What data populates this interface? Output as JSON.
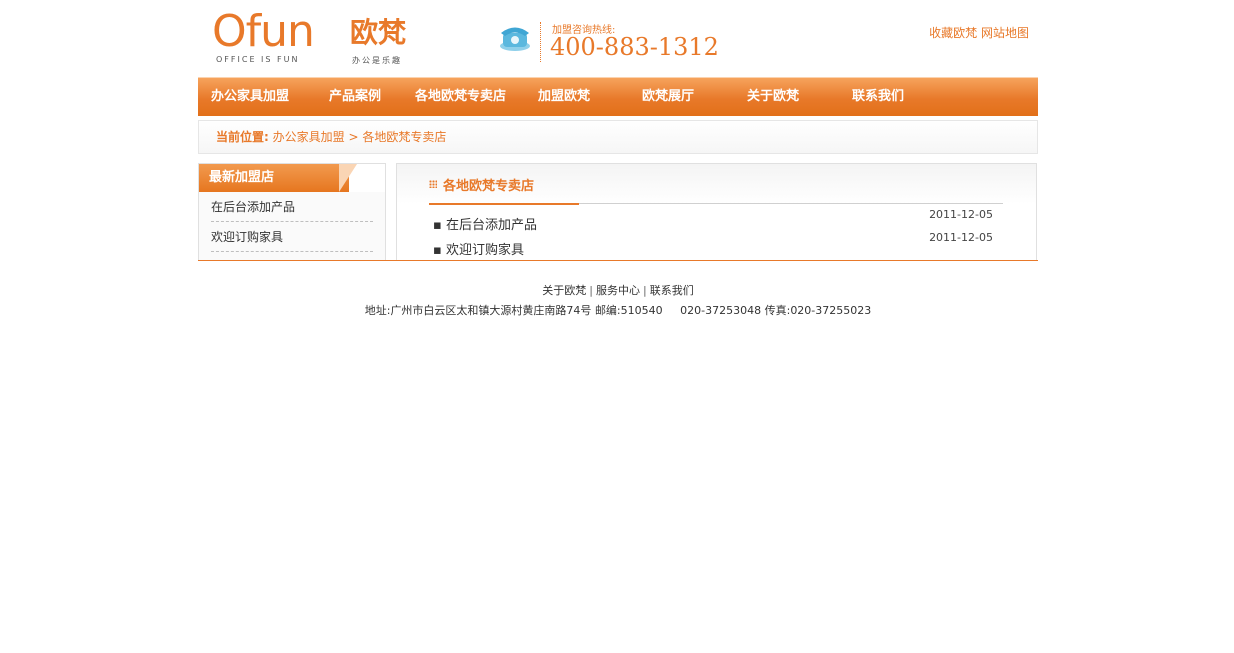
{
  "header": {
    "logo_en": "Ofun",
    "logo_cn": "欧梵",
    "logo_slogan_en": "OFFICE IS FUN",
    "logo_slogan_cn": "办公是乐趣",
    "hotline_label": "加盟咨询热线:",
    "hotline_number": "400-883-1312",
    "top_links": [
      "收藏欧梵",
      "网站地图"
    ]
  },
  "nav": {
    "items": [
      "办公家具加盟",
      "产品案例",
      "各地欧梵专卖店",
      "加盟欧梵",
      "欧梵展厅",
      "关于欧梵",
      "联系我们"
    ]
  },
  "breadcrumb": {
    "label": "当前位置:",
    "path": [
      "办公家具加盟",
      "各地欧梵专卖店"
    ],
    "separator": " > "
  },
  "sidebar": {
    "title": "最新加盟店",
    "items": [
      "在后台添加产品",
      "欢迎订购家具"
    ]
  },
  "content": {
    "title": "各地欧梵专卖店",
    "news": [
      {
        "title": "在后台添加产品",
        "date": "2011-12-05"
      },
      {
        "title": "欢迎订购家具",
        "date": "2011-12-05"
      }
    ]
  },
  "footer": {
    "links": [
      "关于欧梵",
      "服务中心",
      "联系我们"
    ],
    "address_label": "地址:",
    "address": "广州市白云区太和镇大源村黄庄南路74号",
    "zip_label": "邮编:",
    "zip": "510540",
    "phone": "020-37253048",
    "fax_label": "传真:",
    "fax": "020-37255023"
  },
  "colors": {
    "accent": "#e8792a",
    "text": "#333333"
  }
}
